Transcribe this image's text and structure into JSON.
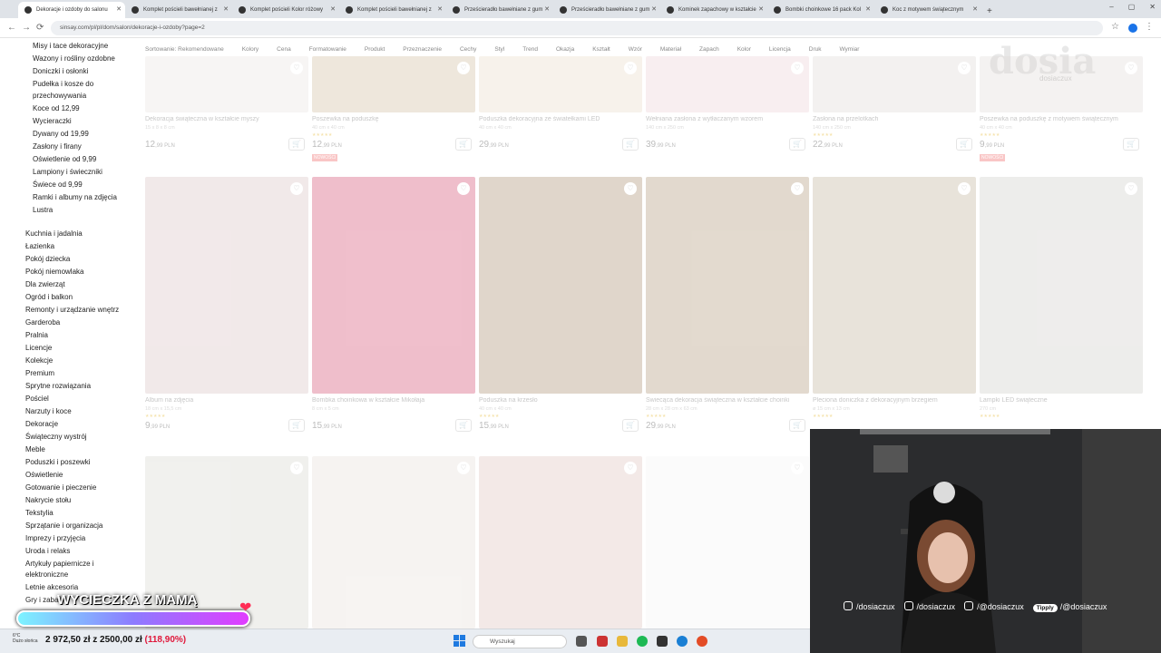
{
  "browser": {
    "tabs": [
      {
        "title": "Dekoracje i ozdoby do salonu",
        "active": true
      },
      {
        "title": "Komplet pościeli bawełnianej z",
        "active": false
      },
      {
        "title": "Komplet pościeli Kolor różowy",
        "active": false
      },
      {
        "title": "Komplet pościeli bawełnianej z",
        "active": false
      },
      {
        "title": "Prześcieradło bawełniane z gum",
        "active": false
      },
      {
        "title": "Prześcieradło bawełniane z gum",
        "active": false
      },
      {
        "title": "Kominek zapachowy w kształcie",
        "active": false
      },
      {
        "title": "Bombki choinkowe 16 pack Kol",
        "active": false
      },
      {
        "title": "Koc z motywem świątecznym",
        "active": false
      }
    ],
    "new_tab": "+",
    "url": "sinsay.com/pl/pl/dom/salon/dekoracje-i-ozdoby?page=2",
    "back": "←",
    "forward": "→",
    "reload": "⟳",
    "bookmark": "☆",
    "menu": "⋮",
    "window_controls": [
      "–",
      "▢",
      "✕"
    ]
  },
  "sidebar": {
    "sub_items": [
      "Misy i tace dekoracyjne",
      "Wazony i rośliny ozdobne",
      "Doniczki i osłonki",
      "Pudełka i kosze do",
      "przechowywania",
      "Koce od 12,99",
      "Wycieraczki",
      "Dywany od 19,99",
      "Zasłony i firany",
      "Oświetlenie od 9,99",
      "Lampiony i świeczniki",
      "Świece od 9,99",
      "Ramki i albumy na zdjęcia",
      "Lustra"
    ],
    "categories": [
      "Kuchnia i jadalnia",
      "Łazienka",
      "Pokój dziecka",
      "Pokój niemowlaka",
      "Dla zwierząt",
      "Ogród i balkon",
      "Remonty i urządzanie wnętrz",
      "Garderoba",
      "Pralnia",
      "Licencje",
      "Kolekcje",
      "Premium",
      "Sprytne rozwiązania",
      "Pościel",
      "Narzuty i koce",
      "Dekoracje",
      "Świąteczny wystrój",
      "Meble",
      "Poduszki i poszewki",
      "Oświetlenie",
      "Gotowanie i pieczenie",
      "Nakrycie stołu",
      "Tekstylia",
      "Sprzątanie i organizacja",
      "Imprezy i przyjęcia",
      "Uroda i relaks",
      "Artykuły papiernicze i",
      "elektroniczne",
      "Letnie akcesoria",
      "Gry i zaba"
    ]
  },
  "filters": [
    "Sortowanie: Rekomendowane",
    "Kolory",
    "Cena",
    "Formatowanie",
    "Produkt",
    "Przeznaczenie",
    "Cechy",
    "Styl",
    "Trend",
    "Okazja",
    "Kształt",
    "Wzór",
    "Materiał",
    "Zapach",
    "Kolor",
    "Licencja",
    "Druk",
    "Wymiar"
  ],
  "watermark": {
    "logo": "dosia",
    "handle": "dosiaczux"
  },
  "products_row1": [
    {
      "name": "Dekoracja świąteczna w kształcie myszy",
      "dims": "15 x 8 x 8 cm",
      "price_int": "12",
      "price_dec": ",99 PLN",
      "badge": "",
      "rating": ""
    },
    {
      "name": "Poszewka na poduszkę",
      "dims": "40 cm x 40 cm",
      "price_int": "12",
      "price_dec": ",99 PLN",
      "badge": "NOWOŚCI",
      "rating": "★★★★★"
    },
    {
      "name": "Poduszka dekoracyjna ze światełkami LED",
      "dims": "40 cm x 40 cm",
      "price_int": "29",
      "price_dec": ",99 PLN",
      "badge": "",
      "rating": ""
    },
    {
      "name": "Wełniana zasłona z wytłaczanym wzorem",
      "dims": "140 cm x 250 cm",
      "price_int": "39",
      "price_dec": ",99 PLN",
      "badge": "",
      "rating": ""
    },
    {
      "name": "Zasłona na przelotkach",
      "dims": "140 cm x 250 cm",
      "price_int": "22",
      "price_dec": ",99 PLN",
      "badge": "",
      "rating": "★★★★★"
    },
    {
      "name": "Poszewka na poduszkę z motywem świątecznym",
      "dims": "40 cm x 40 cm",
      "price_int": "9",
      "price_dec": ",99 PLN",
      "badge": "NOWOŚCI",
      "rating": "★★★★★"
    }
  ],
  "products_row2": [
    {
      "name": "Album na zdjęcia",
      "dims": "18 cm x 15,5 cm",
      "price_int": "9",
      "price_dec": ",99 PLN",
      "rating": "★★★★★"
    },
    {
      "name": "Bombka choinkowa w kształcie Mikołaja",
      "dims": "8 cm x 5 cm",
      "price_int": "15",
      "price_dec": ",99 PLN",
      "rating": ""
    },
    {
      "name": "Poduszka na krzesło",
      "dims": "40 cm x 40 cm",
      "price_int": "15",
      "price_dec": ",99 PLN",
      "rating": "★★★★★"
    },
    {
      "name": "Świecąca dekoracja świąteczna w kształcie choinki",
      "dims": "28 cm x 28 cm x 63 cm",
      "price_int": "29",
      "price_dec": ",99 PLN",
      "rating": "★★★★★"
    },
    {
      "name": "Pleciona doniczka z dekoracyjnym brzegiem",
      "dims": "ø 15 cm x 13 cm",
      "price_int": "",
      "price_dec": "",
      "rating": "★★★★★"
    },
    {
      "name": "Lampki LED świąteczne",
      "dims": "270 cm",
      "price_int": "",
      "price_dec": "",
      "rating": "★★★★★"
    }
  ],
  "socials": {
    "instagram": "/dosiaczux",
    "tiktok": "/dosiaczux",
    "youtube": "/@dosiaczux",
    "tipply_label": "Tipply",
    "tipply": "/@dosiaczux"
  },
  "goal": {
    "title": "WYCIECZKA Z MAMĄ",
    "amount": "2 972,50 zł z 2500,00 zł",
    "percent": "(118,90%)",
    "progress": 1.189
  },
  "taskbar": {
    "search_placeholder": "Wyszukaj",
    "weather_temp": "6°C",
    "weather_desc": "Dużo słońca"
  },
  "colors": {
    "card_pink": "#cc2a55",
    "goal_gradient_start": "#7df3ff",
    "goal_gradient_end": "#e13dff",
    "percent_red": "#e0173a"
  }
}
